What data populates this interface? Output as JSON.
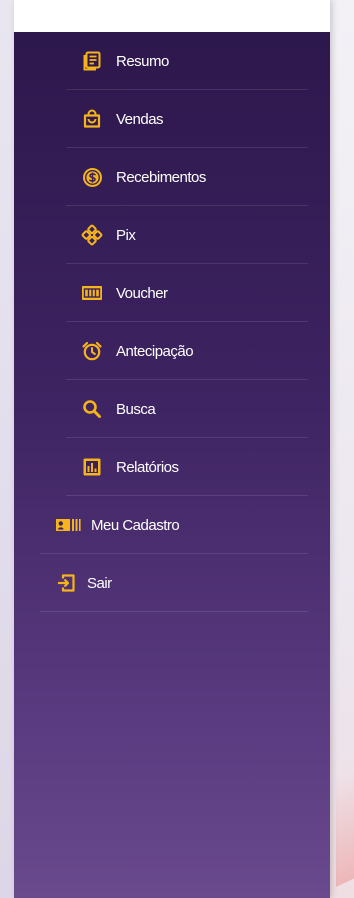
{
  "colors": {
    "icon_accent": "#F5B41A",
    "sidebar_top": "#2B164A",
    "sidebar_bottom": "#6A4A8D"
  },
  "menu": {
    "items": [
      {
        "label": "Resumo",
        "icon": "document-list-icon"
      },
      {
        "label": "Vendas",
        "icon": "shopping-bag-icon"
      },
      {
        "label": "Recebimentos",
        "icon": "dollar-coin-icon"
      },
      {
        "label": "Pix",
        "icon": "pix-icon"
      },
      {
        "label": "Voucher",
        "icon": "voucher-ticket-icon"
      },
      {
        "label": "Antecipação",
        "icon": "alarm-clock-icon"
      },
      {
        "label": "Busca",
        "icon": "search-icon"
      },
      {
        "label": "Relatórios",
        "icon": "bar-chart-icon"
      }
    ],
    "bottom_items": [
      {
        "label": "Meu Cadastro",
        "icon": "id-card-icon"
      },
      {
        "label": "Sair",
        "icon": "logout-icon"
      }
    ]
  }
}
